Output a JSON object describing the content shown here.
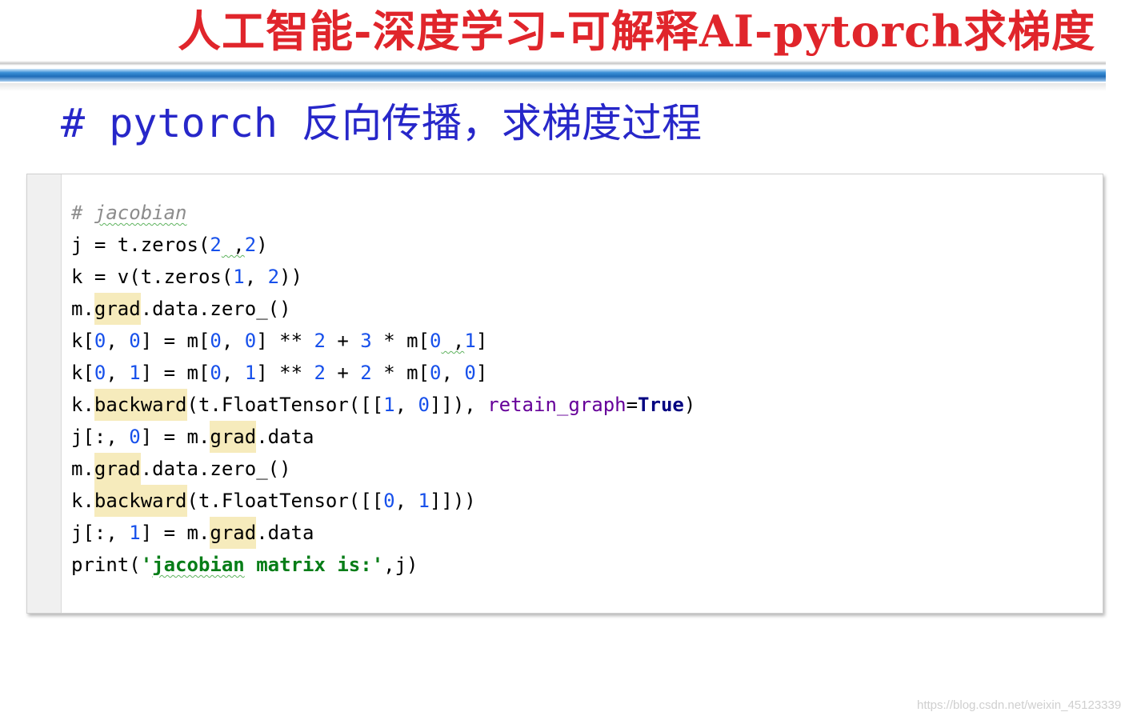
{
  "slide": {
    "title": "人工智能-深度学习-可解释AI-pytorch求梯度",
    "heading": "# pytorch 反向传播，求梯度过程"
  },
  "code": {
    "lines": [
      [
        {
          "t": "# ",
          "c": "cm"
        },
        {
          "t": "jacobian",
          "c": "cm squig"
        }
      ],
      [
        {
          "t": "j = t.zeros("
        },
        {
          "t": "2",
          "c": "num"
        },
        {
          "t": " ,",
          "c": "squig"
        },
        {
          "t": "2",
          "c": "num"
        },
        {
          "t": ")"
        }
      ],
      [
        {
          "t": "k = v(t.zeros("
        },
        {
          "t": "1",
          "c": "num"
        },
        {
          "t": ", "
        },
        {
          "t": "2",
          "c": "num"
        },
        {
          "t": "))"
        }
      ],
      [
        {
          "t": "m."
        },
        {
          "t": "grad",
          "c": "hl"
        },
        {
          "t": ".data.zero_()"
        }
      ],
      [
        {
          "t": "k["
        },
        {
          "t": "0",
          "c": "num"
        },
        {
          "t": ", "
        },
        {
          "t": "0",
          "c": "num"
        },
        {
          "t": "] = m["
        },
        {
          "t": "0",
          "c": "num"
        },
        {
          "t": ", "
        },
        {
          "t": "0",
          "c": "num"
        },
        {
          "t": "] ** "
        },
        {
          "t": "2",
          "c": "num"
        },
        {
          "t": " + "
        },
        {
          "t": "3",
          "c": "num"
        },
        {
          "t": " * m["
        },
        {
          "t": "0",
          "c": "num"
        },
        {
          "t": " ,",
          "c": "squig"
        },
        {
          "t": "1",
          "c": "num"
        },
        {
          "t": "]"
        }
      ],
      [
        {
          "t": "k["
        },
        {
          "t": "0",
          "c": "num"
        },
        {
          "t": ", "
        },
        {
          "t": "1",
          "c": "num"
        },
        {
          "t": "] = m["
        },
        {
          "t": "0",
          "c": "num"
        },
        {
          "t": ", "
        },
        {
          "t": "1",
          "c": "num"
        },
        {
          "t": "] ** "
        },
        {
          "t": "2",
          "c": "num"
        },
        {
          "t": " + "
        },
        {
          "t": "2",
          "c": "num"
        },
        {
          "t": " * m["
        },
        {
          "t": "0",
          "c": "num"
        },
        {
          "t": ", "
        },
        {
          "t": "0",
          "c": "num"
        },
        {
          "t": "]"
        }
      ],
      [
        {
          "t": "k."
        },
        {
          "t": "backward",
          "c": "hl"
        },
        {
          "t": "(t.FloatTensor([["
        },
        {
          "t": "1",
          "c": "num"
        },
        {
          "t": ", "
        },
        {
          "t": "0",
          "c": "num"
        },
        {
          "t": "]]), "
        },
        {
          "t": "retain_graph",
          "c": "kwarg"
        },
        {
          "t": "="
        },
        {
          "t": "True",
          "c": "kw"
        },
        {
          "t": ")"
        }
      ],
      [
        {
          "t": "j[:, "
        },
        {
          "t": "0",
          "c": "num"
        },
        {
          "t": "] = m."
        },
        {
          "t": "grad",
          "c": "hl"
        },
        {
          "t": ".data"
        }
      ],
      [
        {
          "t": "m."
        },
        {
          "t": "grad",
          "c": "hl"
        },
        {
          "t": ".data.zero_()"
        }
      ],
      [
        {
          "t": "k."
        },
        {
          "t": "backward",
          "c": "hl"
        },
        {
          "t": "(t.FloatTensor([["
        },
        {
          "t": "0",
          "c": "num"
        },
        {
          "t": ", "
        },
        {
          "t": "1",
          "c": "num"
        },
        {
          "t": "]]))"
        }
      ],
      [
        {
          "t": "j[:, "
        },
        {
          "t": "1",
          "c": "num"
        },
        {
          "t": "] = m."
        },
        {
          "t": "grad",
          "c": "hl"
        },
        {
          "t": ".data"
        }
      ],
      [
        {
          "t": "print("
        },
        {
          "t": "'",
          "c": "str"
        },
        {
          "t": "jacobian",
          "c": "str squig"
        },
        {
          "t": " matrix is:'",
          "c": "str"
        },
        {
          "t": ",j)"
        }
      ]
    ]
  },
  "watermark": "https://blog.csdn.net/weixin_45123339"
}
